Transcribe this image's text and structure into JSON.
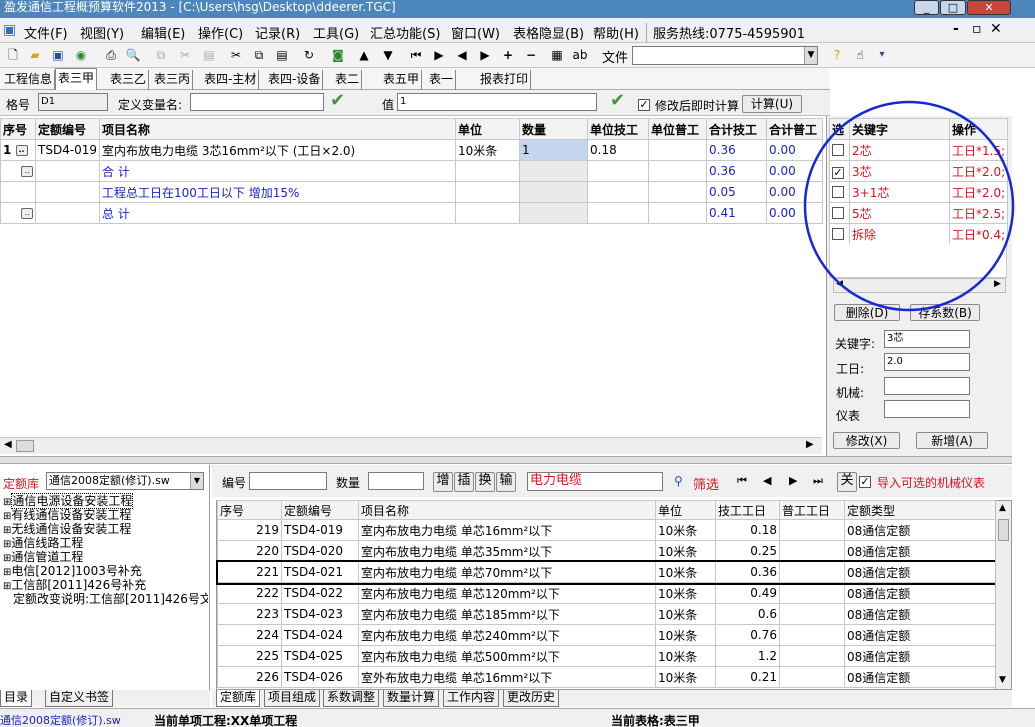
{
  "window": {
    "title": "盈发通信工程概预算软件2013 - [C:\\Users\\hsg\\Desktop\\ddeerer.TGC]"
  },
  "menu": [
    "文件(F)",
    "视图(Y)",
    "编辑(E)",
    "操作(C)",
    "记录(R)",
    "工具(G)",
    "汇总功能(S)",
    "窗口(W)",
    "表格隐显(B)",
    "帮助(H)"
  ],
  "hotline": "服务热线:0775-4595901",
  "toolbar": {
    "file_label": "文件"
  },
  "tabs": [
    "工程信息",
    "表三甲",
    "表三乙",
    "表三丙",
    "表四-主材",
    "表四-设备",
    "表二",
    "表五甲",
    "表一",
    "报表打印"
  ],
  "varbar": {
    "gehao_label": "格号",
    "gehao_value": "D1",
    "varname_label": "定义变量名:",
    "varname_value": "",
    "value_label": "值",
    "value_value": "1",
    "auto_calc_label": "修改后即时计算",
    "calc_button": "计算(U)"
  },
  "main_table": {
    "headers": [
      "序号",
      "定额编号",
      "项目名称",
      "单位",
      "数量",
      "单位技工",
      "单位普工",
      "合计技工",
      "合计普工"
    ],
    "rows": [
      {
        "seq": "1",
        "code": "TSD4-019",
        "name": "室内布放电力电缆 3芯16mm²以下 (工日×2.0)",
        "unit": "10米条",
        "qty": "1",
        "unit_skill": "0.18",
        "unit_general": "",
        "total_skill": "0.36",
        "total_general": "0.00"
      },
      {
        "seq": "",
        "code": "",
        "name": "合  计",
        "unit": "",
        "qty": "",
        "unit_skill": "",
        "unit_general": "",
        "total_skill": "0.36",
        "total_general": "0.00"
      },
      {
        "seq": "",
        "code": "",
        "name": "工程总工日在100工日以下 增加15%",
        "unit": "",
        "qty": "",
        "unit_skill": "",
        "unit_general": "",
        "total_skill": "0.05",
        "total_general": "0.00"
      },
      {
        "seq": "",
        "code": "",
        "name": "总  计",
        "unit": "",
        "qty": "",
        "unit_skill": "",
        "unit_general": "",
        "total_skill": "0.41",
        "total_general": "0.00"
      }
    ]
  },
  "right_panel": {
    "headers": [
      "选",
      "关键字",
      "操作"
    ],
    "rows": [
      {
        "checked": false,
        "key": "2芯",
        "op": "工日*1.5;"
      },
      {
        "checked": true,
        "key": "3芯",
        "op": "工日*2.0;"
      },
      {
        "checked": false,
        "key": "3+1芯",
        "op": "工日*2.0;"
      },
      {
        "checked": false,
        "key": "5芯",
        "op": "工日*2.5;"
      },
      {
        "checked": false,
        "key": "拆除",
        "op": "工日*0.4;"
      }
    ],
    "delete_button": "删除(D)",
    "save_coef_button": "存系数(B)",
    "keyword_label": "关键字:",
    "keyword_value": "3芯",
    "workday_label": "工日:",
    "workday_value": "2.0",
    "machine_label": "机械:",
    "machine_value": "",
    "meter_label": "仪表",
    "meter_value": "",
    "modify_button": "修改(X)",
    "add_button": "新增(A)"
  },
  "quota_lib": {
    "label": "定额库",
    "select": "通信2008定额(修订).sw"
  },
  "tree": [
    "通信电源设备安装工程",
    "有线通信设备安装工程",
    "无线通信设备安装工程",
    "通信线路工程",
    "通信管道工程",
    "电信[2012]1003号补充",
    "工信部[2011]426号补充",
    "定额改变说明:工信部[2011]426号文"
  ],
  "left_tabs": [
    "目录",
    "自定义书签"
  ],
  "search": {
    "code_label": "编号",
    "code_value": "",
    "qty_label": "数量",
    "qty_value": "",
    "buttons": [
      "增",
      "插",
      "换",
      "输"
    ],
    "filter_text": "电力电缆",
    "filter_button": "筛选",
    "close_button": "关",
    "import_label": "导入可选的机械仪表"
  },
  "lower_table": {
    "headers": [
      "序号",
      "定额编号",
      "项目名称",
      "单位",
      "技工工日",
      "普工工日",
      "定额类型"
    ],
    "rows": [
      {
        "seq": "219",
        "code": "TSD4-019",
        "name": "室内布放电力电缆 单芯16mm²以下",
        "unit": "10米条",
        "skill": "0.18",
        "general": "",
        "type": "08通信定额"
      },
      {
        "seq": "220",
        "code": "TSD4-020",
        "name": "室内布放电力电缆 单芯35mm²以下",
        "unit": "10米条",
        "skill": "0.25",
        "general": "",
        "type": "08通信定额"
      },
      {
        "seq": "221",
        "code": "TSD4-021",
        "name": "室内布放电力电缆 单芯70mm²以下",
        "unit": "10米条",
        "skill": "0.36",
        "general": "",
        "type": "08通信定额"
      },
      {
        "seq": "222",
        "code": "TSD4-022",
        "name": "室内布放电力电缆 单芯120mm²以下",
        "unit": "10米条",
        "skill": "0.49",
        "general": "",
        "type": "08通信定额"
      },
      {
        "seq": "223",
        "code": "TSD4-023",
        "name": "室内布放电力电缆 单芯185mm²以下",
        "unit": "10米条",
        "skill": "0.6",
        "general": "",
        "type": "08通信定额"
      },
      {
        "seq": "224",
        "code": "TSD4-024",
        "name": "室内布放电力电缆 单芯240mm²以下",
        "unit": "10米条",
        "skill": "0.76",
        "general": "",
        "type": "08通信定额"
      },
      {
        "seq": "225",
        "code": "TSD4-025",
        "name": "室内布放电力电缆 单芯500mm²以下",
        "unit": "10米条",
        "skill": "1.2",
        "general": "",
        "type": "08通信定额"
      },
      {
        "seq": "226",
        "code": "TSD4-026",
        "name": "室外布放电力电缆 单芯16mm²以下",
        "unit": "10米条",
        "skill": "0.21",
        "general": "",
        "type": "08通信定额"
      }
    ]
  },
  "bottom_tabs": [
    "定额库",
    "项目组成",
    "系数调整",
    "数量计算",
    "工作内容",
    "更改历史"
  ],
  "status": {
    "left": "通信2008定额(修订).sw",
    "project": "当前单项工程:XX单项工程",
    "table": "当前表格:表三甲"
  }
}
